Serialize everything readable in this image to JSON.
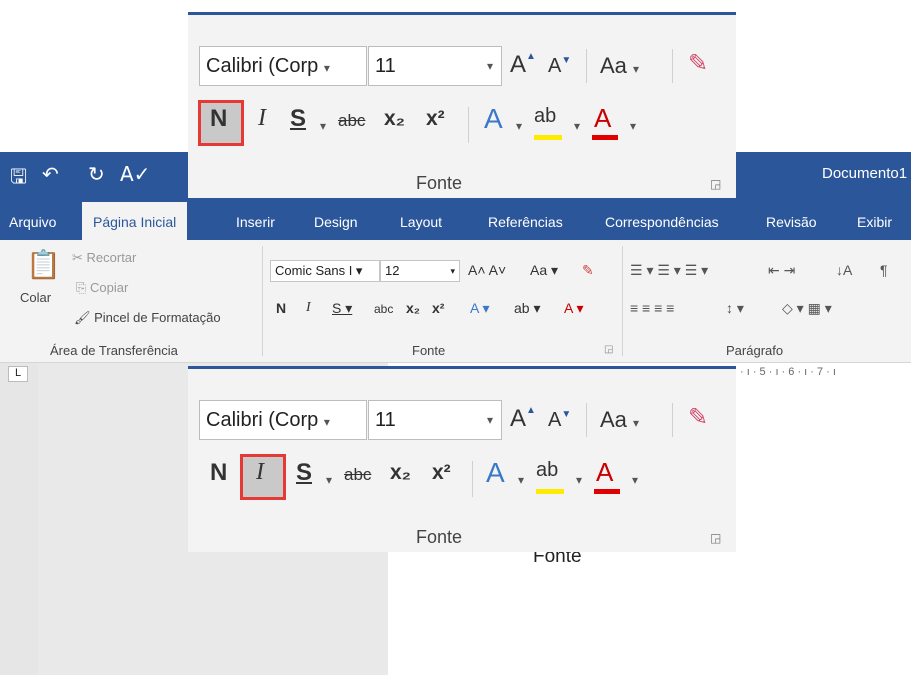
{
  "window": {
    "title": "Documento1",
    "qat_icons": [
      "save-icon",
      "undo-icon",
      "redo-icon",
      "spelling-icon"
    ]
  },
  "tabs": [
    {
      "label": "Arquivo"
    },
    {
      "label": "Página Inicial"
    },
    {
      "label": "Inserir"
    },
    {
      "label": "Design"
    },
    {
      "label": "Layout"
    },
    {
      "label": "Referências"
    },
    {
      "label": "Correspondências"
    },
    {
      "label": "Revisão"
    },
    {
      "label": "Exibir"
    }
  ],
  "clipboard": {
    "paste": "Colar",
    "cut": "Recortar",
    "copy": "Copiar",
    "format_painter": "Pincel de Formatação",
    "group": "Área de Transferência"
  },
  "font_group": {
    "font_name": "Comic Sans I",
    "font_size": "12",
    "group": "Fonte"
  },
  "paragraph_group": {
    "group": "Parágrafo"
  },
  "ruler": {
    "marks": "· ı · 5 · ı · 6 · ı · 7 · ı"
  },
  "document": {
    "text": "Fonte"
  },
  "zoom_panel_1": {
    "font_name": "Calibri (Corp",
    "font_size": "11",
    "aa": "Aa",
    "bold": "N",
    "italic": "I",
    "strike": "S",
    "abc": "abc",
    "sub": "x₂",
    "sup": "x²",
    "group": "Fonte",
    "highlighted": "bold"
  },
  "zoom_panel_2": {
    "font_name": "Calibri (Corp",
    "font_size": "11",
    "aa": "Aa",
    "bold": "N",
    "italic": "I",
    "strike": "S",
    "abc": "abc",
    "sub": "x₂",
    "sup": "x²",
    "group": "Fonte",
    "highlighted": "italic"
  },
  "colors": {
    "accent": "#2b579a",
    "highlight_border": "#e53935",
    "text_highlight": "#ffeb00",
    "font_color": "#e00000"
  }
}
